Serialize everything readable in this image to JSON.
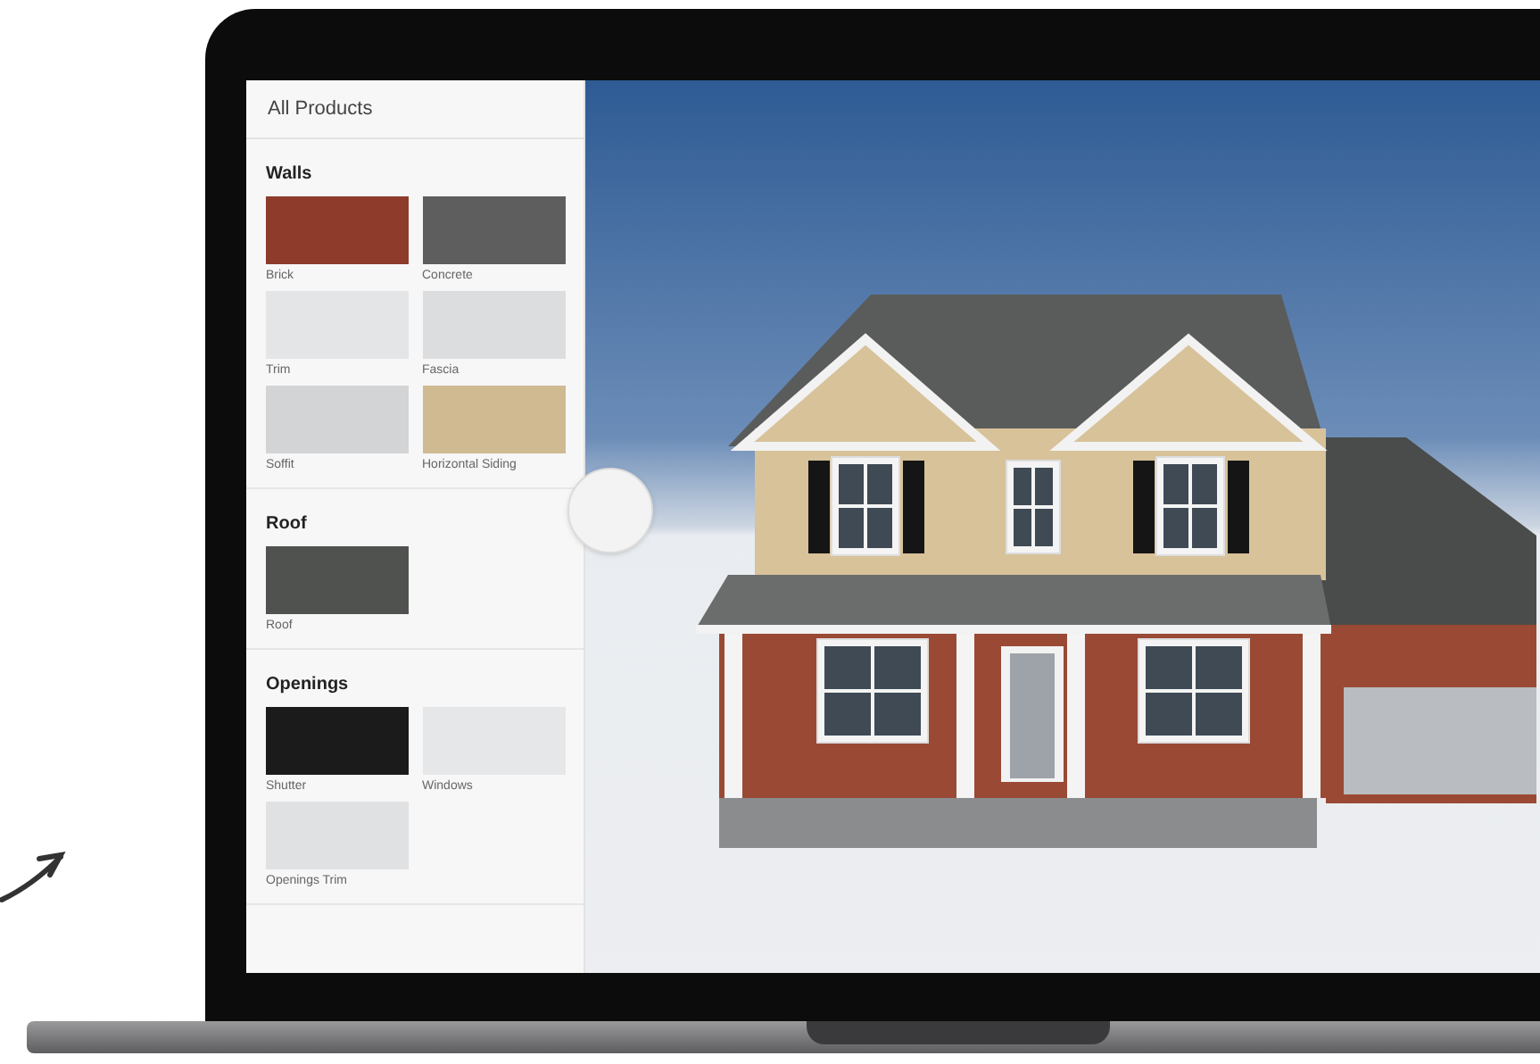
{
  "sidebar": {
    "title": "All Products",
    "sections": [
      {
        "heading": "Walls",
        "items": [
          {
            "label": "Brick",
            "color": "#8e3b2b"
          },
          {
            "label": "Concrete",
            "color": "#5e5e5f"
          },
          {
            "label": "Trim",
            "color": "#e4e5e6"
          },
          {
            "label": "Fascia",
            "color": "#dcdddf"
          },
          {
            "label": "Soffit",
            "color": "#d3d4d6"
          },
          {
            "label": "Horizontal Siding",
            "color": "#cfba92"
          }
        ]
      },
      {
        "heading": "Roof",
        "items": [
          {
            "label": "Roof",
            "color": "#4f524f"
          }
        ]
      },
      {
        "heading": "Openings",
        "items": [
          {
            "label": "Shutter",
            "color": "#1b1b1c"
          },
          {
            "label": "Windows",
            "color": "#e6e7e8"
          },
          {
            "label": "Openings Trim",
            "color": "#e0e1e2"
          }
        ]
      }
    ]
  }
}
